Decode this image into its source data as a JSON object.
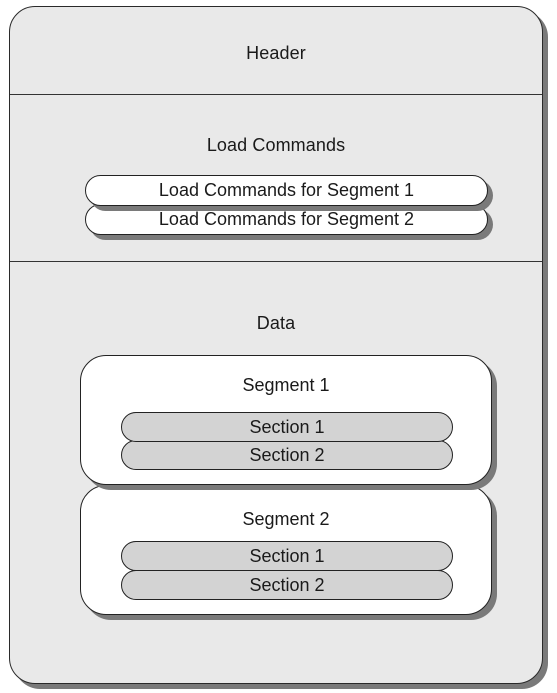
{
  "header": {
    "label": "Header"
  },
  "load_commands": {
    "title": "Load Commands",
    "items": [
      {
        "label": "Load Commands for Segment 1"
      },
      {
        "label": "Load Commands for Segment 2"
      }
    ]
  },
  "data_area": {
    "title": "Data",
    "segments": [
      {
        "title": "Segment 1",
        "sections": [
          {
            "label": "Section 1"
          },
          {
            "label": "Section 2"
          }
        ]
      },
      {
        "title": "Segment 2",
        "sections": [
          {
            "label": "Section 1"
          },
          {
            "label": "Section 2"
          }
        ]
      }
    ]
  },
  "colors": {
    "region_fill": "#e9e9e9",
    "section_fill": "#d3d3d3",
    "shadow": "#7a7a7a",
    "stroke": "#222222"
  }
}
